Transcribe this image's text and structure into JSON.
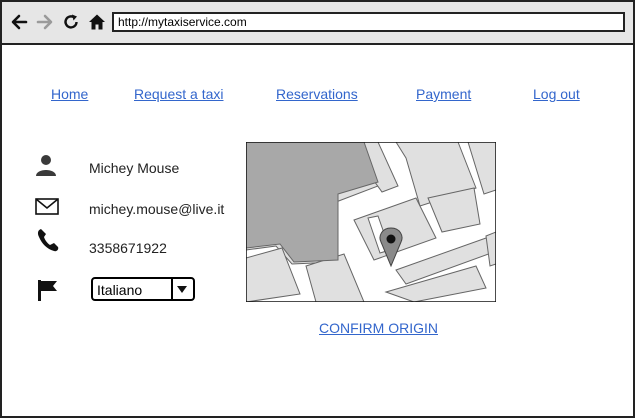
{
  "browser": {
    "url": "http://mytaxiservice.com",
    "icons": [
      "back-arrow-icon",
      "forward-arrow-icon",
      "reload-icon",
      "home-icon"
    ]
  },
  "nav": {
    "home": "Home",
    "request_taxi": "Request a taxi",
    "reservations": "Reservations",
    "payment": "Payment",
    "logout": "Log out"
  },
  "profile": {
    "name": "Michey Mouse",
    "email": "michey.mouse@live.it",
    "phone": "3358671922",
    "language": "Italiano",
    "icons": [
      "user-icon",
      "envelope-icon",
      "phone-icon",
      "flag-icon"
    ]
  },
  "map": {
    "confirm_label": "CONFIRM ORIGIN"
  },
  "colors": {
    "link": "#3366cc",
    "toolbar": "#e6e6e6",
    "border": "#222222"
  }
}
